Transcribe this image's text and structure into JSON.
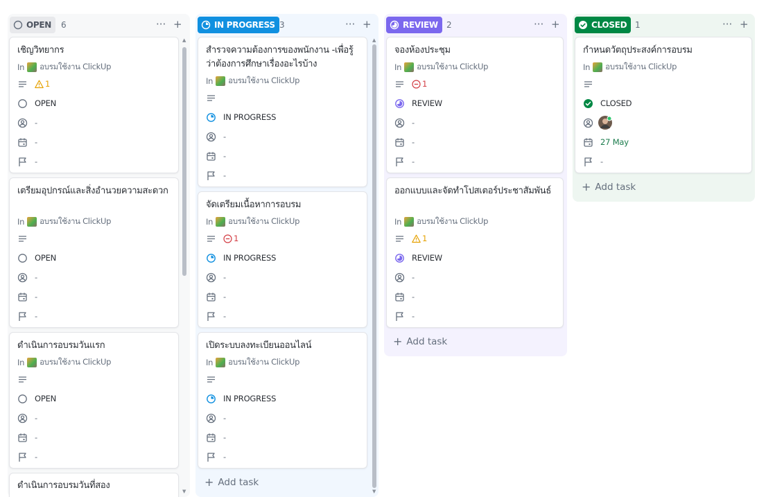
{
  "board": {
    "columns": [
      {
        "status": "OPEN",
        "count": "6",
        "color": "#656f7d",
        "pill_bg": "#e8e9ec",
        "pill_fg": "#4e5561",
        "tasks": [
          {
            "title": "เชิญวิทยากร",
            "in": "In",
            "list": "อบรมใช้งาน ClickUp",
            "priority": "1",
            "priority_type": "warning",
            "status": "OPEN",
            "assignee": "-",
            "date": "-",
            "flag": "-"
          },
          {
            "title": "เตรียมอุปกรณ์และสิ่งอำนวยความสะดวก",
            "in": "In",
            "list": "อบรมใช้งาน ClickUp",
            "priority": "",
            "priority_type": "",
            "status": "OPEN",
            "assignee": "-",
            "date": "-",
            "flag": "-"
          },
          {
            "title": "ดำเนินการอบรมวันแรก",
            "in": "In",
            "list": "อบรมใช้งาน ClickUp",
            "priority": "",
            "priority_type": "",
            "status": "OPEN",
            "assignee": "-",
            "date": "-",
            "flag": "-"
          },
          {
            "title": "ดำเนินการอบรมวันที่สอง",
            "in": "",
            "list": "",
            "priority": "",
            "priority_type": "",
            "status": "",
            "assignee": "",
            "date": "",
            "flag": ""
          }
        ]
      },
      {
        "status": "IN PROGRESS",
        "count": "3",
        "color": "#1090e0",
        "pill_bg": "#1090e0",
        "pill_fg": "#ffffff",
        "tasks": [
          {
            "title": "สำรวจความต้องการของพนักงาน -เพื่อรู้ว่าต้องการศึกษาเรื่องอะไรบ้าง",
            "in": "In",
            "list": "อบรมใช้งาน ClickUp",
            "priority": "",
            "priority_type": "",
            "status": "IN PROGRESS",
            "assignee": "-",
            "date": "-",
            "flag": "-"
          },
          {
            "title": "จัดเตรียมเนื้อหาการอบรม",
            "in": "In",
            "list": "อบรมใช้งาน ClickUp",
            "priority": "1",
            "priority_type": "urgent",
            "status": "IN PROGRESS",
            "assignee": "-",
            "date": "-",
            "flag": "-"
          },
          {
            "title": "เปิดระบบลงทะเบียนออนไลน์",
            "in": "In",
            "list": "อบรมใช้งาน ClickUp",
            "priority": "",
            "priority_type": "",
            "status": "IN PROGRESS",
            "assignee": "-",
            "date": "-",
            "flag": "-"
          }
        ],
        "add_task": "Add task"
      },
      {
        "status": "REVIEW",
        "count": "2",
        "color": "#7b68ee",
        "pill_bg": "#7b68ee",
        "pill_fg": "#ffffff",
        "tasks": [
          {
            "title": "จองห้องประชุม",
            "in": "In",
            "list": "อบรมใช้งาน ClickUp",
            "priority": "1",
            "priority_type": "urgent",
            "status": "REVIEW",
            "assignee": "-",
            "date": "-",
            "flag": "-"
          },
          {
            "title": "ออกแบบและจัดทำโปสเตอร์ประชาสัมพันธ์",
            "in": "In",
            "list": "อบรมใช้งาน ClickUp",
            "priority": "1",
            "priority_type": "warning",
            "status": "REVIEW",
            "assignee": "-",
            "date": "-",
            "flag": "-"
          }
        ],
        "add_task": "Add task"
      },
      {
        "status": "CLOSED",
        "count": "1",
        "color": "#008844",
        "pill_bg": "#008844",
        "pill_fg": "#ffffff",
        "tasks": [
          {
            "title": "กำหนดวัตถุประสงค์การอบรม",
            "in": "In",
            "list": "อบรมใช้งาน ClickUp",
            "priority": "",
            "priority_type": "",
            "status": "CLOSED",
            "assignee": "avatar",
            "date": "27 May",
            "flag": "-"
          }
        ],
        "add_task": "Add task"
      }
    ]
  },
  "header_actions": {
    "more": "···",
    "add": "+"
  }
}
